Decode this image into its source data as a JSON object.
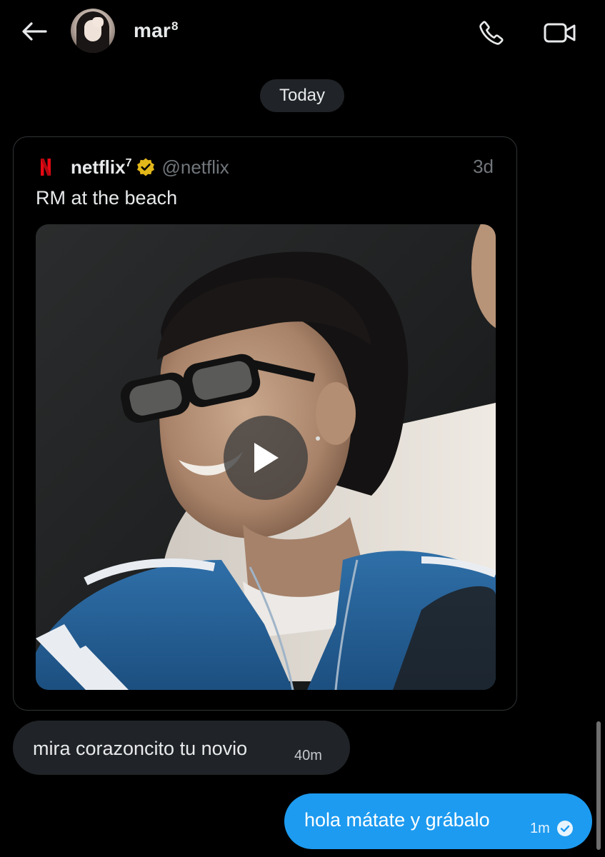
{
  "header": {
    "contact_name": "mar",
    "contact_name_sup": "8",
    "icons": {
      "back": "arrow-left-icon",
      "call": "phone-icon",
      "video": "video-camera-icon"
    }
  },
  "date_separator": "Today",
  "shared_post": {
    "author": "netflix",
    "author_sup": "7",
    "handle": "@netflix",
    "time": "3d",
    "text": "RM at the beach",
    "media_type": "video",
    "icons": {
      "logo": "netflix-logo-icon",
      "verified": "gold-verified-badge-icon",
      "play": "play-icon"
    }
  },
  "messages": [
    {
      "direction": "received",
      "text": "mira corazoncito tu novio",
      "time": "40m"
    },
    {
      "direction": "sent",
      "text": "hola mátate y grábalo",
      "time": "1m",
      "status_icon": "seen-check-icon"
    }
  ],
  "colors": {
    "background": "#000000",
    "received_bubble": "#202327",
    "sent_bubble": "#1d9bf0",
    "muted_text": "#71767b",
    "verified_gold": "#e2b719",
    "netflix_red": "#e50914"
  }
}
